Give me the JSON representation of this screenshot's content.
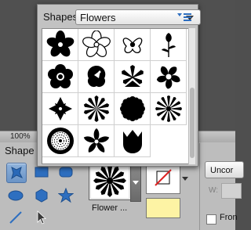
{
  "popup": {
    "label": "Shapes",
    "category": "Flowers",
    "menu_icon": "panel-menu-icon",
    "shapes": [
      "flower-1",
      "flower-2-outline",
      "flower-3-orchid",
      "flower-4-stem",
      "flower-5",
      "flower-6-hibiscus",
      "flower-7-lily",
      "flower-8-pinwheel",
      "flower-9-four-petal",
      "flower-10-star",
      "flower-11-daisy",
      "flower-12-aster",
      "flower-13-sunflower",
      "flower-14-five-petal",
      "flower-15-tulip"
    ]
  },
  "status": {
    "zoom": "100%"
  },
  "panel": {
    "section_title": "Shape",
    "tools": [
      "custom-shape-icon",
      "rectangle-icon",
      "rounded-rectangle-icon",
      "ellipse-icon",
      "polygon-icon",
      "star-icon",
      "line-icon",
      "selection-arrow-icon"
    ],
    "current_shape_label": "Flower ...",
    "style_icon": "no-style-icon",
    "color": "#fdf3a4",
    "uncon_label": "Uncor",
    "w_label": "W:",
    "from_label": "Fron"
  }
}
